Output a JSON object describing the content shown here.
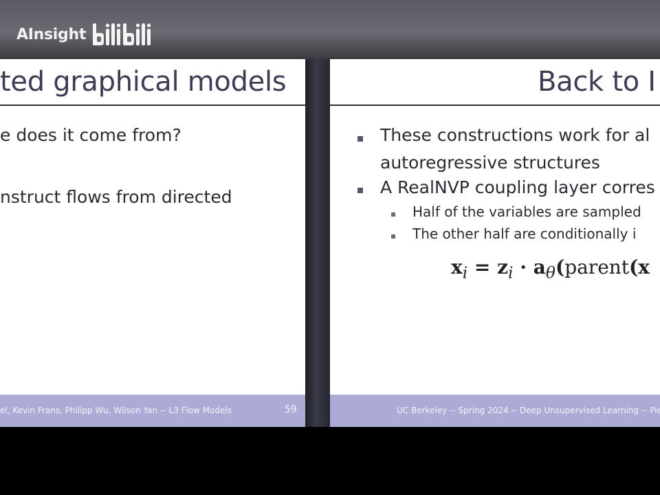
{
  "watermark": {
    "text": "AInsight",
    "logo_text": "bilibili"
  },
  "left_slide": {
    "title": "ted graphical models",
    "bullets": [
      "e does it come from?",
      "nstruct flows from directed"
    ],
    "footer_text": "el, Kevin Frans, Philipp Wu, Wilson Yan -- L3 Flow Models",
    "page_number": "59"
  },
  "right_slide": {
    "title": "Back to I",
    "bullets": [
      {
        "line1": "These constructions work for al",
        "line2": "autoregressive structures"
      },
      {
        "line1": "A RealNVP coupling layer corres",
        "line2": ""
      }
    ],
    "sub_bullets": [
      "Half of the variables are sampled",
      "The other half are conditionally i"
    ],
    "equation": "x_i = z_i · a_θ(parent(x",
    "footer_text": "UC Berkeley -- Spring 2024 -- Deep Unsupervised Learning -- Piet"
  },
  "colors": {
    "title": "#3c3c55",
    "footer": "#ababd6",
    "topbar": "#626269"
  }
}
